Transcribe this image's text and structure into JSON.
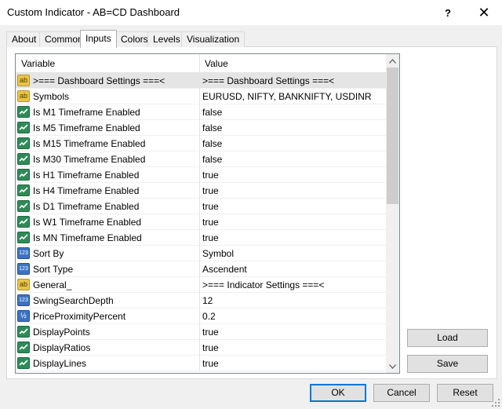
{
  "window": {
    "title": "Custom Indicator - AB=CD Dashboard",
    "help_label": "?",
    "close_label": "✕"
  },
  "tabs": [
    {
      "label": "About"
    },
    {
      "label": "Common"
    },
    {
      "label": "Inputs"
    },
    {
      "label": "Colors"
    },
    {
      "label": "Levels"
    },
    {
      "label": "Visualization"
    }
  ],
  "grid": {
    "col_variable": "Variable",
    "col_value": "Value",
    "rows": [
      {
        "icon": "ab",
        "variable": ">=== Dashboard Settings ===<",
        "value": ">=== Dashboard Settings ===<"
      },
      {
        "icon": "ab",
        "variable": "Symbols",
        "value": "EURUSD, NIFTY, BANKNIFTY, USDINR"
      },
      {
        "icon": "bool",
        "variable": "Is M1 Timeframe Enabled",
        "value": "false"
      },
      {
        "icon": "bool",
        "variable": "Is M5 Timeframe Enabled",
        "value": "false"
      },
      {
        "icon": "bool",
        "variable": "Is M15 Timeframe Enabled",
        "value": "false"
      },
      {
        "icon": "bool",
        "variable": "Is M30 Timeframe Enabled",
        "value": "false"
      },
      {
        "icon": "bool",
        "variable": "Is H1 Timeframe Enabled",
        "value": "true"
      },
      {
        "icon": "bool",
        "variable": "Is H4 Timeframe Enabled",
        "value": "true"
      },
      {
        "icon": "bool",
        "variable": "Is D1 Timeframe Enabled",
        "value": "true"
      },
      {
        "icon": "bool",
        "variable": "Is W1 Timeframe Enabled",
        "value": "true"
      },
      {
        "icon": "bool",
        "variable": "Is MN Timeframe Enabled",
        "value": "true"
      },
      {
        "icon": "int",
        "variable": "Sort By",
        "value": "Symbol"
      },
      {
        "icon": "int",
        "variable": "Sort Type",
        "value": "Ascendent"
      },
      {
        "icon": "ab",
        "variable": "General_",
        "value": ">=== Indicator Settings ===<"
      },
      {
        "icon": "int",
        "variable": "SwingSearchDepth",
        "value": "12"
      },
      {
        "icon": "double",
        "variable": "PriceProximityPercent",
        "value": "0.2"
      },
      {
        "icon": "bool",
        "variable": "DisplayPoints",
        "value": "true"
      },
      {
        "icon": "bool",
        "variable": "DisplayRatios",
        "value": "true"
      },
      {
        "icon": "bool",
        "variable": "DisplayLines",
        "value": "true"
      }
    ]
  },
  "icon_labels": {
    "ab": "ab",
    "int": "123",
    "double": "½"
  },
  "buttons": {
    "load": "Load",
    "save": "Save",
    "ok": "OK",
    "cancel": "Cancel",
    "reset": "Reset"
  },
  "colors": {
    "accent": "#0078d7",
    "ab_icon": "#e8c44a",
    "bool_icon": "#2e8b57",
    "int_icon": "#3b73c4"
  }
}
